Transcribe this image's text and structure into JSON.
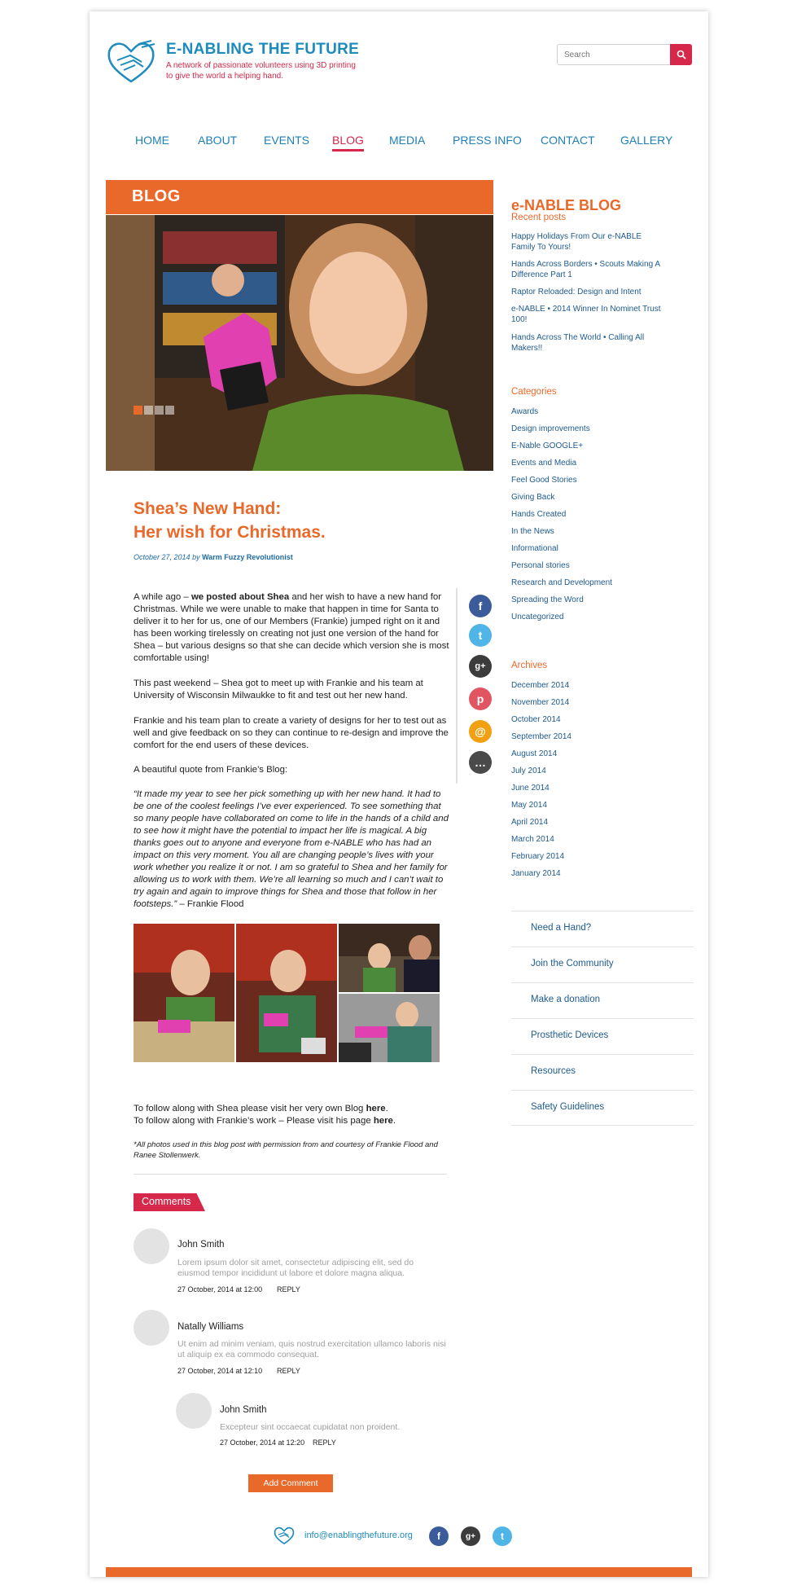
{
  "header": {
    "site_title": "E-NABLING THE FUTURE",
    "tagline": "A network of passionate volunteers using 3D printing to give the world a helping hand.",
    "search_placeholder": "Search"
  },
  "nav": {
    "items": [
      {
        "label": "HOME"
      },
      {
        "label": "ABOUT"
      },
      {
        "label": "EVENTS"
      },
      {
        "label": "BLOG",
        "active": true
      },
      {
        "label": "MEDIA"
      },
      {
        "label": "PRESS INFO"
      },
      {
        "label": "CONTACT"
      },
      {
        "label": "GALLERY"
      }
    ]
  },
  "banner": {
    "label": "BLOG"
  },
  "post": {
    "title_line1": "Shea’s New Hand:",
    "title_line2": "Her wish for Christmas.",
    "date": "October 27, 2014",
    "by": " by ",
    "author": "Warm Fuzzy Revolutionist",
    "p1_pre": "A while ago – ",
    "p1_link": "we posted about Shea",
    "p1_post": " and her wish to have a new hand for Christmas. While we were unable to make that happen in time for Santa to deliver it to her for us, one of our Members (Frankie) jumped right on it and has been working tirelessly on creating not just one version of the hand for Shea – but various designs so that she can decide which version she is most comfortable using!",
    "p2": "This past weekend – Shea got to meet up with Frankie and his team at University of Wisconsin Milwaukke to fit and test out her new hand.",
    "p3": "Frankie and his team plan to create a variety of designs for her to test out as well and give feedback on so they can continue to re-design and improve the comfort for the end users of  these devices.",
    "p4": "A beautiful quote from Frankie’s Blog:",
    "quote": "“It made my year to see her pick something up with her new hand. It had to be one of the coolest feelings I’ve ever experienced. To see something that so many people have collaborated on come to life in the hands of a child and to see how it might have the potential to impact her life is magical. A big thanks goes out to anyone and everyone from e-NABLE who has had an impact on this very moment. You all are changing people’s lives with your work whether you realize it or not. I am so grateful to Shea and her family for allowing us to work with them. We’re all learning so much and I can’t wait to try again and again to improve things for Shea and those that follow in her footsteps.”",
    "quote_author": " – Frankie Flood",
    "follow1_pre": "To follow along with Shea please visit her very own Blog ",
    "follow1_link": "here",
    "follow2_pre": "To follow along with Frankie’s work – Please visit his page ",
    "follow2_link": "here",
    "period": ".",
    "credits": "*All photos used in this blog post with permission from and courtesy of Frankie Flood and Ranee Stollenwerk."
  },
  "share": {
    "facebook": "f",
    "twitter": "t",
    "googleplus": "g+",
    "pinterest": "p",
    "email": "@",
    "comment": "…"
  },
  "comments": {
    "title": "Comments",
    "items": [
      {
        "name": "John Smith",
        "text": "Lorem ipsum dolor sit amet, consectetur adipiscing elit, sed do eiusmod tempor incididunt ut labore et dolore magna aliqua.",
        "date": "27 October, 2014 at 12:00",
        "reply": "REPLY"
      },
      {
        "name": "Natally Williams",
        "text": "Ut enim ad minim veniam, quis nostrud exercitation ullamco laboris nisi ut aliquip ex ea commodo consequat.",
        "date": "27 October, 2014 at 12:10",
        "reply": "REPLY"
      },
      {
        "name": "John Smith",
        "text": "Excepteur sint occaecat cupidatat non proident.",
        "date": "27 October, 2014 at 12:20",
        "reply": "REPLY"
      }
    ],
    "add_label": "Add Comment"
  },
  "sidebar": {
    "title": "e-NABLE BLOG",
    "recent_heading": "Recent posts",
    "recent": [
      "Happy Holidays From Our e-NABLE Family To Yours!",
      "Hands Across Borders • Scouts Making A Difference Part 1",
      "Raptor Reloaded: Design and Intent",
      "e-NABLE • 2014 Winner In Nominet Trust 100!",
      "Hands Across The World • Calling All Makers!!"
    ],
    "categories_heading": "Categories",
    "categories": [
      "Awards",
      "Design improvements",
      "E-Nable GOOGLE+",
      "Events and Media",
      "Feel Good Stories",
      "Giving Back",
      "Hands Created",
      "In the News",
      "Informational",
      "Personal stories",
      "Research and Development",
      "Spreading the Word",
      "Uncategorized"
    ],
    "archives_heading": "Archives",
    "archives": [
      "December 2014",
      "November 2014",
      "October 2014",
      "September 2014",
      "August 2014",
      "July 2014",
      "June 2014",
      "May 2014",
      "April 2014",
      "March 2014",
      "February 2014",
      "January 2014"
    ],
    "boxes": [
      "Need a Hand?",
      "Join the Community",
      "Make a donation",
      "Prosthetic Devices",
      "Resources",
      "Safety Guidelines"
    ]
  },
  "footer": {
    "email": "info@enablingthefuture.org",
    "facebook": "f",
    "googleplus": "g+",
    "twitter": "t"
  },
  "colors": {
    "orange": "#e8692a",
    "red": "#d6284a",
    "blue": "#1e8bbd",
    "link_blue": "#1e5a8e"
  }
}
